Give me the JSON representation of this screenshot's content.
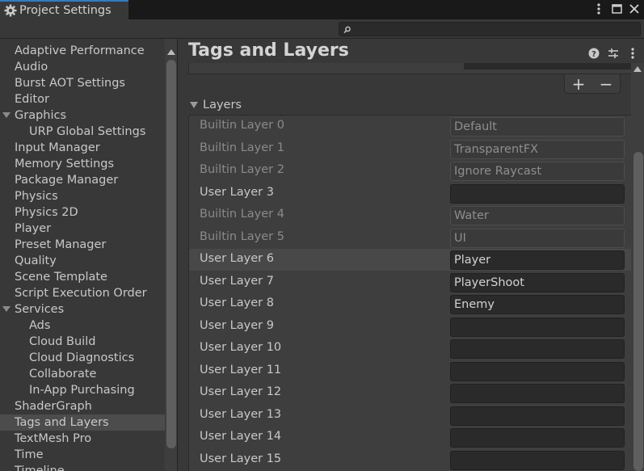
{
  "window": {
    "title": "Project Settings",
    "icons": [
      "gear-icon",
      "kebab-menu-icon",
      "maximize-icon",
      "close-icon"
    ]
  },
  "search": {
    "value": "",
    "placeholder": ""
  },
  "sidebar": {
    "items": [
      {
        "label": "Adaptive Performance",
        "level": 0
      },
      {
        "label": "Audio",
        "level": 0
      },
      {
        "label": "Burst AOT Settings",
        "level": 0
      },
      {
        "label": "Editor",
        "level": 0
      },
      {
        "label": "Graphics",
        "level": 0,
        "expanded": true
      },
      {
        "label": "URP Global Settings",
        "level": 1
      },
      {
        "label": "Input Manager",
        "level": 0
      },
      {
        "label": "Memory Settings",
        "level": 0
      },
      {
        "label": "Package Manager",
        "level": 0
      },
      {
        "label": "Physics",
        "level": 0
      },
      {
        "label": "Physics 2D",
        "level": 0
      },
      {
        "label": "Player",
        "level": 0
      },
      {
        "label": "Preset Manager",
        "level": 0
      },
      {
        "label": "Quality",
        "level": 0
      },
      {
        "label": "Scene Template",
        "level": 0
      },
      {
        "label": "Script Execution Order",
        "level": 0
      },
      {
        "label": "Services",
        "level": 0,
        "expanded": true
      },
      {
        "label": "Ads",
        "level": 1
      },
      {
        "label": "Cloud Build",
        "level": 1
      },
      {
        "label": "Cloud Diagnostics",
        "level": 1
      },
      {
        "label": "Collaborate",
        "level": 1
      },
      {
        "label": "In-App Purchasing",
        "level": 1
      },
      {
        "label": "ShaderGraph",
        "level": 0
      },
      {
        "label": "Tags and Layers",
        "level": 0,
        "selected": true
      },
      {
        "label": "TextMesh Pro",
        "level": 0
      },
      {
        "label": "Time",
        "level": 0
      },
      {
        "label": "Timeline",
        "level": 0
      }
    ]
  },
  "main": {
    "title": "Tags and Layers",
    "header_icons": [
      "help-icon",
      "presets-icon",
      "kebab-menu-icon"
    ],
    "add_label": "+",
    "remove_label": "−",
    "layers_section": "Layers",
    "layers": [
      {
        "label": "Builtin Layer 0",
        "value": "Default",
        "builtin": true
      },
      {
        "label": "Builtin Layer 1",
        "value": "TransparentFX",
        "builtin": true
      },
      {
        "label": "Builtin Layer 2",
        "value": "Ignore Raycast",
        "builtin": true
      },
      {
        "label": "User Layer 3",
        "value": "",
        "builtin": false
      },
      {
        "label": "Builtin Layer 4",
        "value": "Water",
        "builtin": true
      },
      {
        "label": "Builtin Layer 5",
        "value": "UI",
        "builtin": true
      },
      {
        "label": "User Layer 6",
        "value": "Player",
        "builtin": false,
        "highlighted": true
      },
      {
        "label": "User Layer 7",
        "value": "PlayerShoot",
        "builtin": false
      },
      {
        "label": "User Layer 8",
        "value": "Enemy",
        "builtin": false
      },
      {
        "label": "User Layer 9",
        "value": "",
        "builtin": false
      },
      {
        "label": "User Layer 10",
        "value": "",
        "builtin": false
      },
      {
        "label": "User Layer 11",
        "value": "",
        "builtin": false
      },
      {
        "label": "User Layer 12",
        "value": "",
        "builtin": false
      },
      {
        "label": "User Layer 13",
        "value": "",
        "builtin": false
      },
      {
        "label": "User Layer 14",
        "value": "",
        "builtin": false
      },
      {
        "label": "User Layer 15",
        "value": "",
        "builtin": false
      }
    ]
  },
  "colors": {
    "background": "#383838",
    "titlebar": "#191919",
    "accent": "#3a79bb",
    "selection": "#4c4c4c",
    "field": "#2a2a2a"
  }
}
